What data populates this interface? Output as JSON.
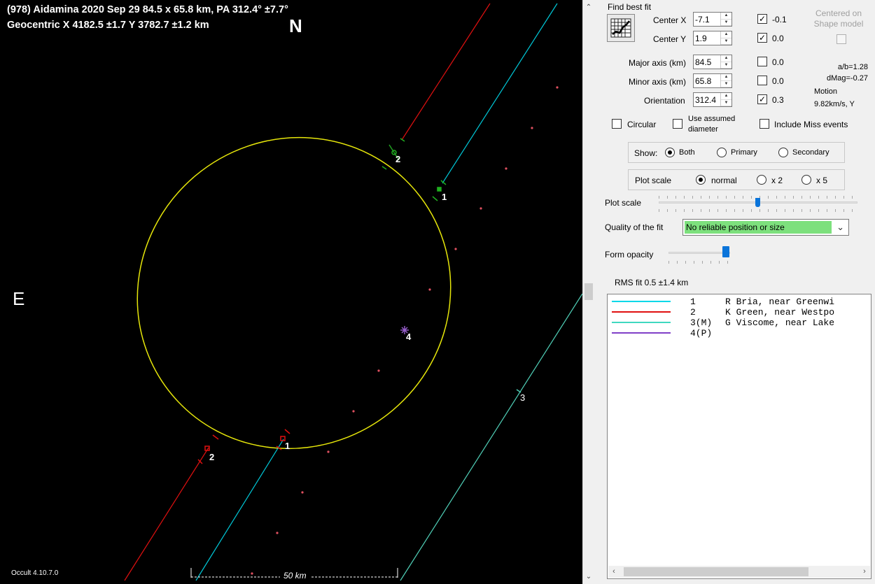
{
  "plot": {
    "title_line1": "(978) Aidamina  2020 Sep 29  84.5 x 65.8 km, PA 312.4° ±7.7°",
    "title_line2": "Geocentric  X  4182.5 ±1.7  Y  3782.7 ±1.2 km",
    "north_label": "N",
    "east_label": "E",
    "version_label": "Occult 4.10.7.0",
    "scale_label": "50 km",
    "chord_labels": {
      "upper_2": "2",
      "upper_1": "1",
      "lower_2": "2",
      "lower_1": "1",
      "chord_3": "3",
      "event_4": "4"
    },
    "colors": {
      "background": "#000000",
      "ellipse": "#e6e60a",
      "chord_1": "#00c8d8",
      "chord_2": "#e01010",
      "chord_3": "#50d0b8",
      "point": "#e05060",
      "event_4": "#9a60d0"
    }
  },
  "panel": {
    "find_best_fit_label": "Find best fit",
    "fit_button_icon": "fit-chart-icon",
    "center_x": {
      "label": "Center X",
      "value": "-7.1",
      "checked": true,
      "step": "-0.1"
    },
    "center_y": {
      "label": "Center Y",
      "value": "1.9",
      "checked": true,
      "step": "0.0"
    },
    "centered_on_shape_model": {
      "label": "Centered on Shape model",
      "checked": false
    },
    "major_axis": {
      "label": "Major axis (km)",
      "value": "84.5",
      "checked": false,
      "step": "0.0"
    },
    "minor_axis": {
      "label": "Minor axis (km)",
      "value": "65.8",
      "checked": false,
      "step": "0.0"
    },
    "orientation": {
      "label": "Orientation",
      "value": "312.4",
      "checked": true,
      "step": "0.3"
    },
    "ab_ratio": "a/b=1.28",
    "dmag": "dMag=-0.27",
    "motion_label": "Motion",
    "motion_value": "9.82km/s, Y",
    "circular": {
      "label": "Circular",
      "checked": false
    },
    "use_assumed_diameter": {
      "label": "Use assumed diameter",
      "checked": false
    },
    "include_miss_events": {
      "label": "Include Miss events",
      "checked": false
    },
    "show": {
      "label": "Show:",
      "options": [
        "Both",
        "Primary",
        "Secondary"
      ],
      "selected": "Both"
    },
    "plot_scale_group": {
      "label": "Plot scale",
      "options": [
        "normal",
        "x 2",
        "x 5"
      ],
      "selected": "normal"
    },
    "plot_scale_slider": {
      "label": "Plot scale",
      "value_fraction": 0.5
    },
    "quality": {
      "label": "Quality of the fit",
      "value": "No reliable position or size",
      "color": "#7de07d"
    },
    "form_opacity": {
      "label": "Form opacity",
      "value_fraction": 1.0
    },
    "rms_fit": "RMS fit 0.5 ±1.4 km",
    "observers": [
      {
        "id": "1",
        "text": "R Bria, near Greenwi",
        "color": "#00d8e8"
      },
      {
        "id": "2",
        "text": "K Green, near Westpo",
        "color": "#e01010"
      },
      {
        "id": "3(M)",
        "text": "G Viscome, near Lake",
        "color": "#40d8c0"
      },
      {
        "id": "4(P)",
        "text": "",
        "color": "#8040c8"
      }
    ]
  }
}
